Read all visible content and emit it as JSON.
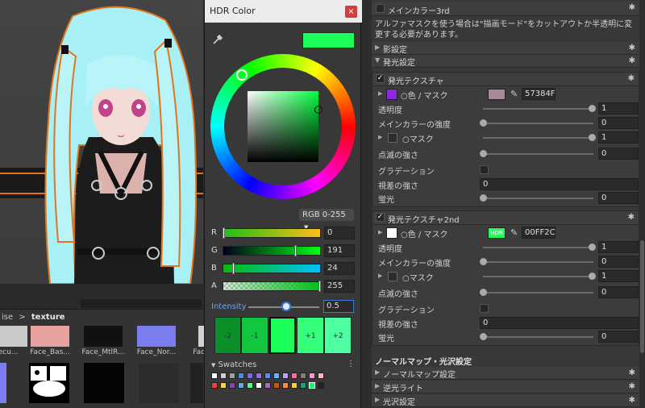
{
  "project": {
    "breadcrumb_prefix": "ise",
    "breadcrumb_sep": ">",
    "breadcrumb_current": "texture",
    "assets": [
      {
        "name": "ecu...",
        "color": "#c9c9c9"
      },
      {
        "name": "Face_Bas...",
        "color": "#e7a2a0"
      },
      {
        "name": "Face_MtlR...",
        "color": "#111111"
      },
      {
        "name": "Face_Nor...",
        "color": "#7a7cf0"
      },
      {
        "name": "Face_...",
        "color": "#d2d2d2"
      }
    ]
  },
  "hdr": {
    "title": "HDR Color",
    "close": "×",
    "mode": "RGB 0-255",
    "channels": [
      {
        "label": "R",
        "value": "0"
      },
      {
        "label": "G",
        "value": "191"
      },
      {
        "label": "B",
        "value": "24"
      },
      {
        "label": "A",
        "value": "255"
      }
    ],
    "intensity_label": "Intensity",
    "intensity_value": "0.5",
    "steps": [
      "-2",
      "-1",
      "",
      "+1",
      "+2"
    ],
    "swatches_label": "Swatches",
    "swatches_menu": "⋮",
    "color": "#1cff5a"
  },
  "inspector": {
    "main_color3": "メインカラー3rd",
    "alpha_note": "アルファマスクを使う場合は\"描画モード\"をカットアウトか半透明に変更する必要があります。",
    "shadow": "影設定",
    "emission": "発光設定",
    "em1": {
      "title": "発光テクスチャ",
      "color_mask": "○色 / マスク",
      "swatch_color": "#8a2be2",
      "tex_color": "#a68a98",
      "hex": "57384F",
      "rows": [
        {
          "label": "透明度",
          "value": "1"
        },
        {
          "label": "メインカラーの強度",
          "value": "0"
        },
        {
          "label": "○マスク",
          "value": "1"
        },
        {
          "label": "点滅の強さ",
          "value": "0"
        },
        {
          "label": "グラデーション",
          "value": ""
        },
        {
          "label": "視差の強さ",
          "value": "0"
        },
        {
          "label": "蛍光",
          "value": "0"
        }
      ]
    },
    "em2": {
      "title": "発光テクスチャ2nd",
      "color_mask": "○色 / マスク",
      "swatch_color": "#ffffff",
      "tex_label": "HDR",
      "hex": "00FF2C",
      "rows": [
        {
          "label": "透明度",
          "value": "1"
        },
        {
          "label": "メインカラーの強度",
          "value": "0"
        },
        {
          "label": "○マスク",
          "value": "1"
        },
        {
          "label": "点滅の強さ",
          "value": "0"
        },
        {
          "label": "グラデーション",
          "value": ""
        },
        {
          "label": "視差の強さ",
          "value": "0"
        },
        {
          "label": "蛍光",
          "value": "0"
        }
      ]
    },
    "normal_header": "ノーマルマップ・光沢設定",
    "normal": "ノーマルマップ設定",
    "backlight": "逆光ライト",
    "gloss": "光沢設定"
  }
}
